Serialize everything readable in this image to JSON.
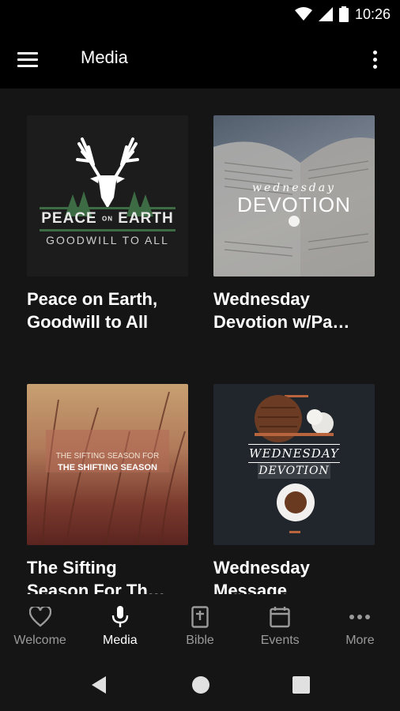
{
  "status_bar": {
    "time": "10:26",
    "icons": [
      "wifi-icon",
      "signal-icon",
      "battery-icon"
    ]
  },
  "app_bar": {
    "title": "Media",
    "menu_icon": "hamburger-menu-icon",
    "overflow_icon": "more-vert-icon"
  },
  "media": {
    "items": [
      {
        "caption": "Peace on Earth, Goodwill to All",
        "thumb_text": {
          "line1": "PEACE",
          "on": "ON",
          "line1b": "EARTH",
          "line2": "GOODWILL TO ALL"
        }
      },
      {
        "caption": "Wednesday Devotion w/Pa…",
        "thumb_text": {
          "script": "wednesday",
          "main": "DEVOTION"
        }
      },
      {
        "caption": "The Sifting Season For Th…",
        "thumb_text": {
          "line1": "THE SIFTING SEASON FOR",
          "line2": "THE SHIFTING SEASON"
        }
      },
      {
        "caption": "Wednesday Message",
        "thumb_text": {
          "line1": "WEDNESDAY",
          "line2": "DEVOTION"
        }
      }
    ]
  },
  "bottom_nav": {
    "items": [
      {
        "label": "Welcome",
        "icon": "heart-icon",
        "active": false
      },
      {
        "label": "Media",
        "icon": "microphone-icon",
        "active": true
      },
      {
        "label": "Bible",
        "icon": "bible-icon",
        "active": false
      },
      {
        "label": "Events",
        "icon": "calendar-icon",
        "active": false
      },
      {
        "label": "More",
        "icon": "more-horiz-icon",
        "active": false
      }
    ]
  },
  "system_nav": {
    "icons": [
      "back-icon",
      "home-icon",
      "recents-icon"
    ]
  },
  "colors": {
    "bar_background": "#000000",
    "page_background": "#151515",
    "nav_inactive": "#9a9a9a",
    "nav_active": "#ffffff",
    "peace_green": "#3d6b43"
  }
}
